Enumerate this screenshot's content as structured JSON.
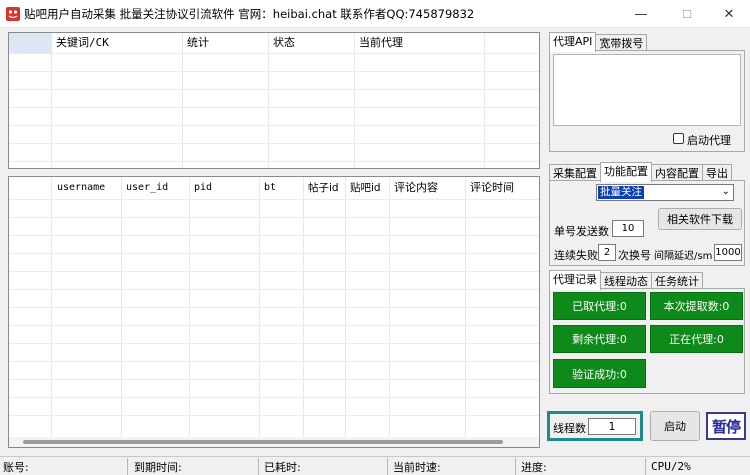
{
  "window": {
    "title": "贴吧用户自动采集 批量关注协议引流软件 官网：heibai.chat 联系作者QQ:745879832",
    "minimize": "—",
    "maximize": "☐",
    "close": "✕"
  },
  "top_table": {
    "columns": [
      "",
      "关键词/CK",
      "统计",
      "状态",
      "当前代理"
    ]
  },
  "bottom_table": {
    "columns": [
      "",
      "username",
      "user_id",
      "pid",
      "bt",
      "帖子id",
      "贴吧id",
      "评论内容",
      "评论时间"
    ]
  },
  "proxy_panel": {
    "tabs": [
      "代理API",
      "宽带拨号"
    ],
    "auto_proxy_label": "启动代理"
  },
  "config_panel": {
    "tabs": [
      "采集配置",
      "功能配置",
      "内容配置",
      "导出"
    ],
    "mode_selected": "批量关注",
    "download_button": "相关软件下载",
    "single_send_label": "单号发送数",
    "single_send_value": "10",
    "fail_label": "连续失败",
    "fail_value": "2",
    "switch_label": "次换号",
    "interval_label": "间隔延迟/sm",
    "interval_value": "1000"
  },
  "record_panel": {
    "tabs": [
      "代理记录",
      "线程动态",
      "任务统计"
    ],
    "buttons": [
      "已取代理:0",
      "本次提取数:0",
      "剩余代理:0",
      "正在代理:0",
      "验证成功:0"
    ]
  },
  "controls": {
    "thread_label": "线程数",
    "thread_value": "1",
    "start_button": "启动",
    "pause_button": "暂停"
  },
  "statusbar": {
    "account": "账号:",
    "expire": "到期时间:",
    "elapsed": "已耗时:",
    "speed": "当前时速:",
    "progress": "进度:",
    "cpu": "CPU/2%"
  },
  "colors": {
    "green": "#0e8a1a",
    "teal_border": "#1e8a8a",
    "select_highlight": "#0a3fb8"
  }
}
